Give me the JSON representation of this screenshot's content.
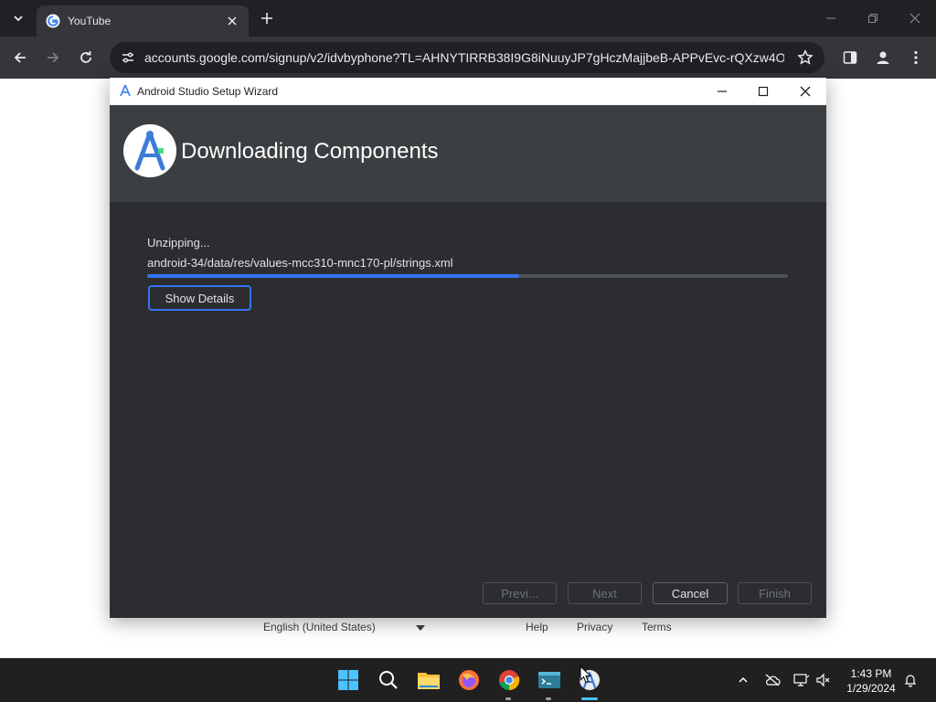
{
  "browser": {
    "tab": {
      "title": "YouTube"
    },
    "address_bar": {
      "url": "accounts.google.com/signup/v2/idvbyphone?TL=AHNYTIRRB38I9G8iNuuyJP7gHczMajjbeB-APPvEvc-rQXzw4OK..."
    }
  },
  "page": {
    "footer": {
      "language": "English (United States)",
      "links": [
        "Help",
        "Privacy",
        "Terms"
      ]
    }
  },
  "dialog": {
    "title": "Android Studio Setup Wizard",
    "heading": "Downloading Components",
    "status": "Unzipping...",
    "file": "android-34/data/res/values-mcc310-mnc170-pl/strings.xml",
    "progress_percent": 58,
    "show_details_label": "Show Details",
    "buttons": {
      "previous": "Previ...",
      "next": "Next",
      "cancel": "Cancel",
      "finish": "Finish"
    },
    "colors": {
      "accent": "#3574f0",
      "background": "#2b2d30",
      "header": "#3c3f41"
    }
  },
  "taskbar": {
    "apps": [
      "windows-start-icon",
      "search-icon",
      "file-explorer-icon",
      "firefox-icon",
      "chrome-icon",
      "terminal-icon",
      "android-studio-icon"
    ],
    "clock": {
      "time": "1:43 PM",
      "date": "1/29/2024"
    }
  }
}
